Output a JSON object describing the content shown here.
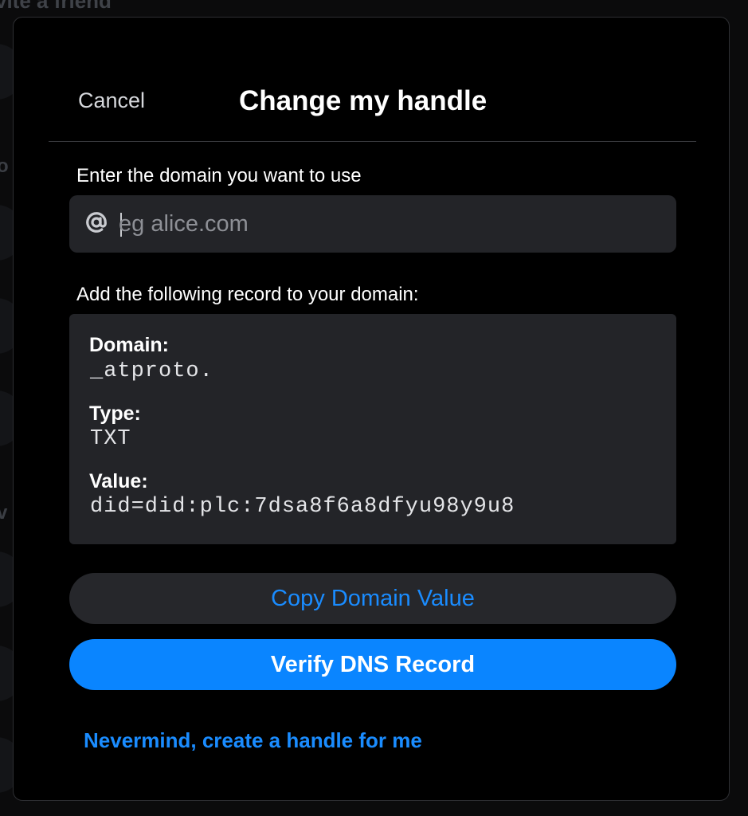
{
  "background": {
    "title": "vite a friend",
    "fragment_letters": [
      "o",
      "v"
    ]
  },
  "header": {
    "cancel_label": "Cancel",
    "title": "Change my handle"
  },
  "domain_input": {
    "label": "Enter the domain you want to use",
    "prefix_icon": "at-icon",
    "value": "",
    "placeholder": "eg alice.com"
  },
  "record": {
    "intro": "Add the following record to your domain:",
    "domain_label": "Domain:",
    "domain_value": "_atproto.",
    "type_label": "Type:",
    "type_value": "TXT",
    "value_label": "Value:",
    "value_value": "did=did:plc:7dsa8f6a8dfyu98y9u8"
  },
  "actions": {
    "copy_label": "Copy Domain Value",
    "verify_label": "Verify DNS Record",
    "nevermind_label": "Nevermind, create a handle for me"
  },
  "colors": {
    "accent": "#0a85ff",
    "link": "#1a8cff",
    "surface": "#232428",
    "background": "#000000"
  }
}
